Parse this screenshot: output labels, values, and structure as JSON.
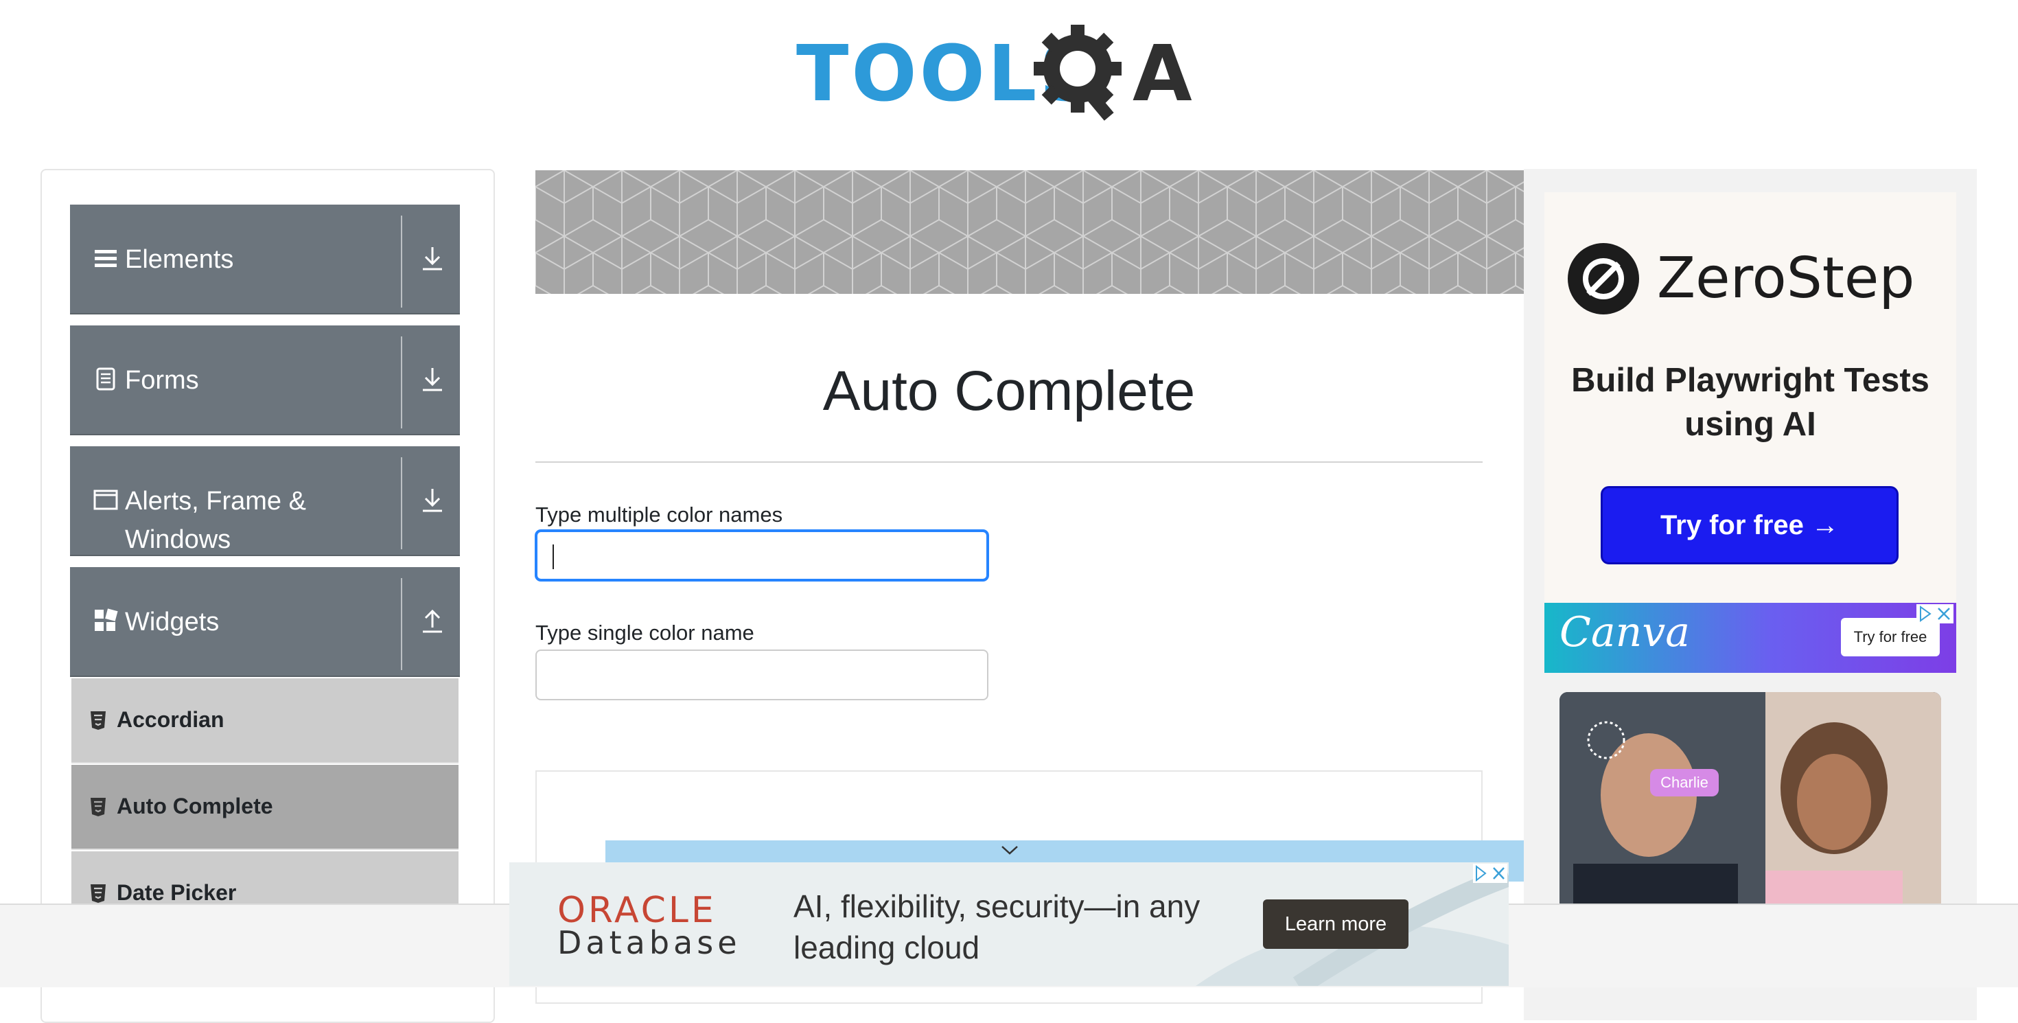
{
  "header": {
    "logo_text": "TOOLS",
    "logo_text_suffix": "QA"
  },
  "sidebar": {
    "groups": [
      {
        "label": "Elements",
        "icon": "hamburger-icon",
        "expanded": false
      },
      {
        "label": "Forms",
        "icon": "document-icon",
        "expanded": false
      },
      {
        "label": "Alerts, Frame & Windows",
        "icon": "window-icon",
        "expanded": false
      },
      {
        "label": "Widgets",
        "icon": "grid-icon",
        "expanded": true
      }
    ],
    "widget_items": [
      {
        "label": "Accordian",
        "icon": "html5-icon",
        "active": false
      },
      {
        "label": "Auto Complete",
        "icon": "html5-icon",
        "active": true
      },
      {
        "label": "Date Picker",
        "icon": "html5-icon",
        "active": false
      }
    ]
  },
  "main": {
    "title": "Auto Complete",
    "fields": [
      {
        "label": "Type multiple color names",
        "value": "",
        "focused": true
      },
      {
        "label": "Type single color name",
        "value": "",
        "focused": false
      }
    ]
  },
  "ads": {
    "zerostep": {
      "brand": "ZeroStep",
      "tagline": "Build Playwright Tests using AI",
      "cta": "Try for free →"
    },
    "canva": {
      "brand": "Canva",
      "cta": "Try for free",
      "tag": "Charlie"
    },
    "oracle": {
      "brand": "ORACLE",
      "product": "Database",
      "text": "AI, flexibility, security—in any leading cloud",
      "cta": "Learn more"
    }
  },
  "colors": {
    "sidebar_group": "#6c757d",
    "sub_item": "#cccccc",
    "sub_item_active": "#a8a8a8",
    "focus": "#2684ff",
    "logo_blue": "#2d9ad9",
    "zerostep_cta": "#1b1cf0"
  }
}
